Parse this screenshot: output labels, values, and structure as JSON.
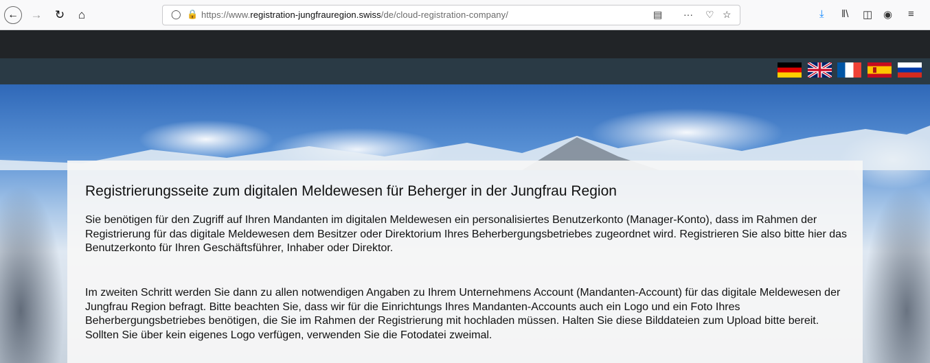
{
  "browser": {
    "url_prefix": "https://www.",
    "url_domain": "registration-jungfrauregion.swiss",
    "url_path": "/de/cloud-registration-company/",
    "icons": [
      "back-icon",
      "forward-icon",
      "reload-icon",
      "home-icon",
      "shield-icon",
      "lock-icon",
      "reader-view-icon",
      "more-icon",
      "pocket-icon",
      "bookmark-star-icon",
      "download-icon",
      "library-icon",
      "sidebar-icon",
      "account-icon",
      "menu-icon"
    ]
  },
  "languages": [
    {
      "name": "german-flag"
    },
    {
      "name": "uk-flag"
    },
    {
      "name": "french-flag"
    },
    {
      "name": "spanish-flag"
    },
    {
      "name": "russian-flag"
    }
  ],
  "content": {
    "title": "Registrierungsseite zum digitalen Meldewesen für Beherger in der Jungfrau Region",
    "paragraph1": "Sie benötigen für den Zugriff auf Ihren Mandanten im digitalen Meldewesen ein personalisiertes Benutzerkonto (Manager-Konto), dass im Rahmen der Registrierung für das digitale Meldewesen dem Besitzer oder Direktorium Ihres Beherbergungsbetriebes zugeordnet wird. Registrieren Sie also bitte hier das Benutzerkonto für Ihren Geschäftsführer, Inhaber oder Direktor.",
    "paragraph2": "Im zweiten Schritt werden Sie dann zu allen notwendigen Angaben zu Ihrem Unternehmens Account (Mandanten-Account) für das digitale Meldewesen der Jungfrau Region befragt. Bitte beachten Sie, dass wir für die Einrichtungs Ihres Mandanten-Accounts auch ein Logo und ein Foto Ihres Beherbergungsbetriebes benötigen, die Sie im Rahmen der Registrierung mit hochladen müssen. Halten Sie diese Bilddateien zum Upload bitte bereit. Sollten Sie über kein eigenes Logo verfügen, verwenden Sie die Fotodatei zweimal."
  },
  "colors": {
    "header_dark": "#212427",
    "header_bar": "#2a3a45",
    "download_accent": "#0a84ff"
  }
}
